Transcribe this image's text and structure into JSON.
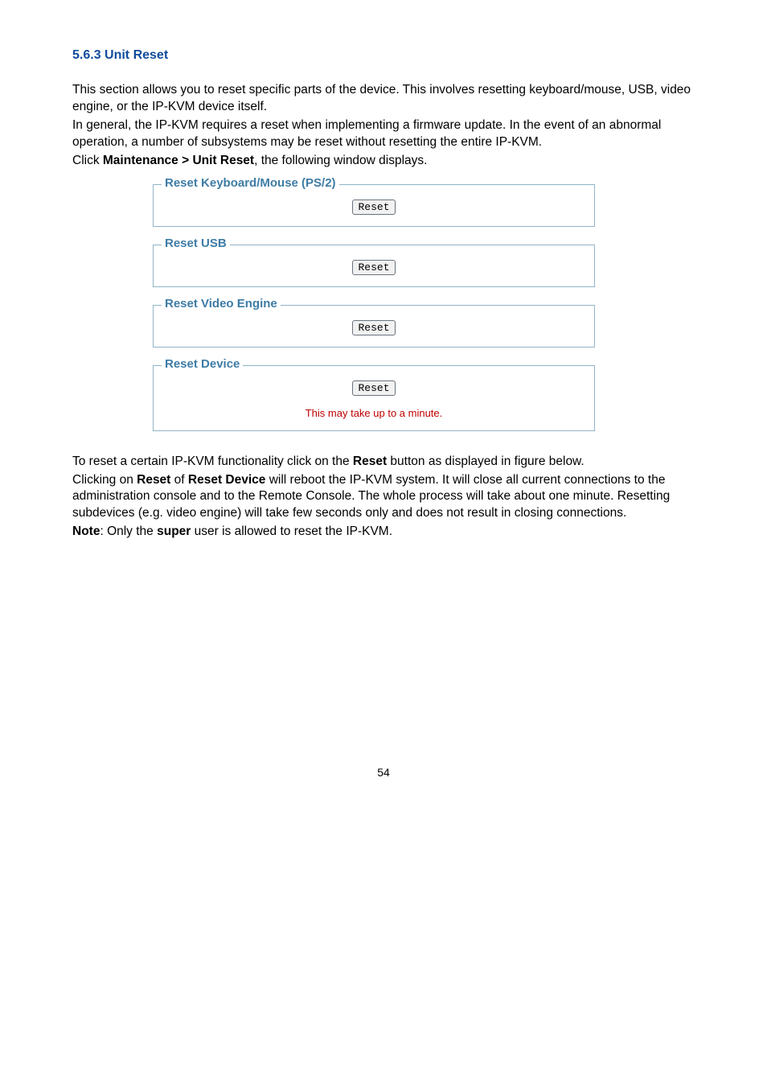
{
  "heading": "5.6.3 Unit Reset",
  "intro": {
    "p1": "This section allows you to reset specific parts of the device. This involves resetting keyboard/mouse, USB, video engine, or the IP-KVM device itself.",
    "p2": "In general, the IP-KVM requires a reset when implementing a firmware update. In the event of an abnormal operation, a number of subsystems may be reset without resetting the entire IP-KVM.",
    "p3a": "Click ",
    "p3b": "Maintenance > Unit Reset",
    "p3c": ", the following window displays."
  },
  "fieldsets": {
    "kbmouse": {
      "legend": "Reset Keyboard/Mouse (PS/2)",
      "button": "Reset"
    },
    "usb": {
      "legend": "Reset USB",
      "button": "Reset"
    },
    "video": {
      "legend": "Reset Video Engine",
      "button": "Reset"
    },
    "device": {
      "legend": "Reset Device",
      "button": "Reset",
      "warn": "This may take up to a minute."
    }
  },
  "outro": {
    "p1a": "To reset a certain IP-KVM functionality click on the ",
    "p1b": "Reset",
    "p1c": " button as displayed in figure below.",
    "p2a": "Clicking on ",
    "p2b": "Reset",
    "p2c": " of ",
    "p2d": "Reset Device",
    "p2e": " will reboot the IP-KVM system. It will close all current connections to the administration console and to the Remote Console. The whole process will take about one minute. Resetting subdevices (e.g. video engine) will take few seconds only and does not result in closing connections.",
    "p3a": "Note",
    "p3b": ": Only the ",
    "p3c": "super",
    "p3d": " user is allowed to reset the IP-KVM."
  },
  "page_number": "54"
}
